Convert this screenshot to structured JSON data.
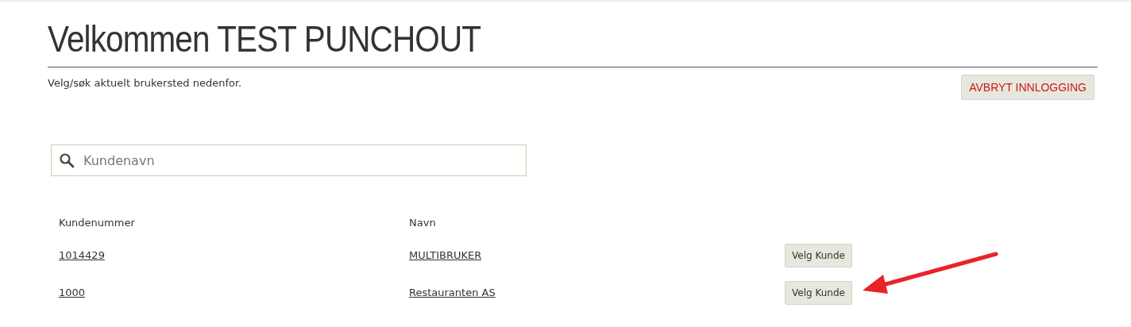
{
  "title": "Velkommen TEST PUNCHOUT",
  "subtitle": "Velg/søk aktuelt brukersted nedenfor.",
  "cancel_button": "AVBRYT INNLOGGING",
  "search": {
    "placeholder": "Kundenavn"
  },
  "table": {
    "columns": [
      "Kundenummer",
      "Navn"
    ],
    "rows": [
      {
        "number": "1014429",
        "name": "MULTIBRUKER",
        "action": "Velg Kunde"
      },
      {
        "number": "1000",
        "name": "Restauranten AS",
        "action": "Velg Kunde"
      }
    ]
  }
}
